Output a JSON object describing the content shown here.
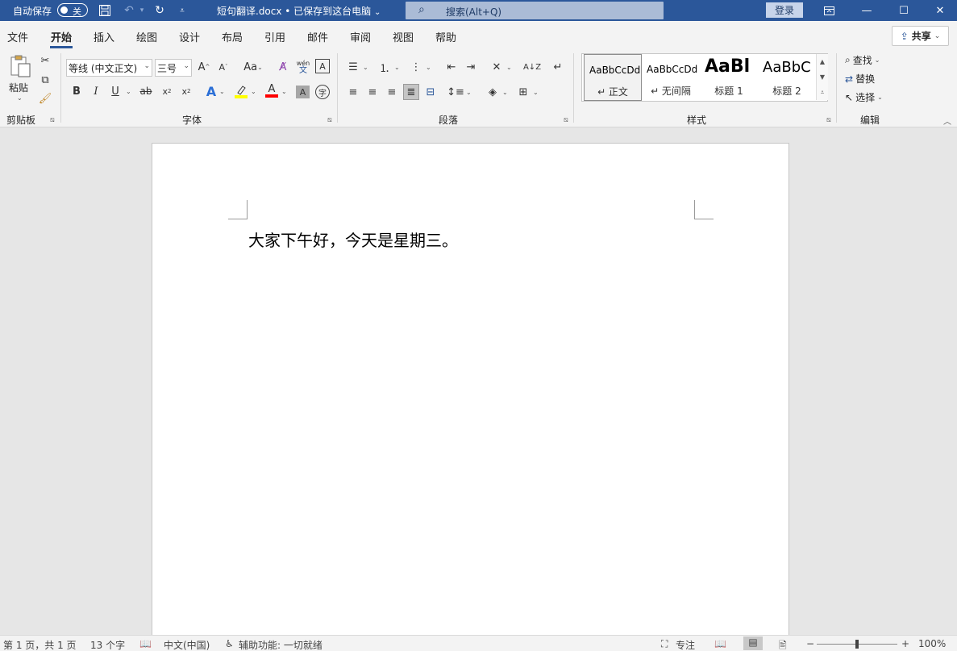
{
  "titlebar": {
    "autosave_label": "自动保存",
    "autosave_state": "关",
    "doc_title": "短句翻译.docx • 已保存到这台电脑",
    "search_placeholder": "搜索(Alt+Q)",
    "signin_label": "登录"
  },
  "menu": {
    "tabs": [
      "文件",
      "开始",
      "插入",
      "绘图",
      "设计",
      "布局",
      "引用",
      "邮件",
      "审阅",
      "视图",
      "帮助"
    ],
    "active_tab": "开始",
    "share_label": "共享"
  },
  "ribbon": {
    "clipboard": {
      "paste_label": "粘贴",
      "group_label": "剪贴板"
    },
    "font": {
      "font_name": "等线 (中文正文)",
      "font_size": "三号",
      "change_case": "Aa",
      "phonetic_top": "wén",
      "phonetic_bottom": "文",
      "group_label": "字体"
    },
    "paragraph": {
      "group_label": "段落"
    },
    "styles": {
      "items": [
        {
          "sample": "AaBbCcDd",
          "name": "↵ 正文"
        },
        {
          "sample": "AaBbCcDd",
          "name": "↵ 无间隔"
        },
        {
          "sample": "AaBl",
          "name": "标题 1"
        },
        {
          "sample": "AaBbC",
          "name": "标题 2"
        }
      ],
      "group_label": "样式"
    },
    "editing": {
      "find_label": "查找",
      "replace_label": "替换",
      "select_label": "选择",
      "group_label": "编辑"
    }
  },
  "document": {
    "text": "大家下午好，今天是星期三。"
  },
  "statusbar": {
    "page_info": "第 1 页，共 1 页",
    "word_count": "13 个字",
    "language": "中文(中国)",
    "accessibility": "辅助功能: 一切就绪",
    "focus_label": "专注",
    "zoom_minus": "−",
    "zoom_plus": "+",
    "zoom_level": "100%"
  },
  "colors": {
    "title_bar": "#2b579a",
    "highlight_yellow": "#ffff00",
    "font_color_red": "#ff0000"
  }
}
